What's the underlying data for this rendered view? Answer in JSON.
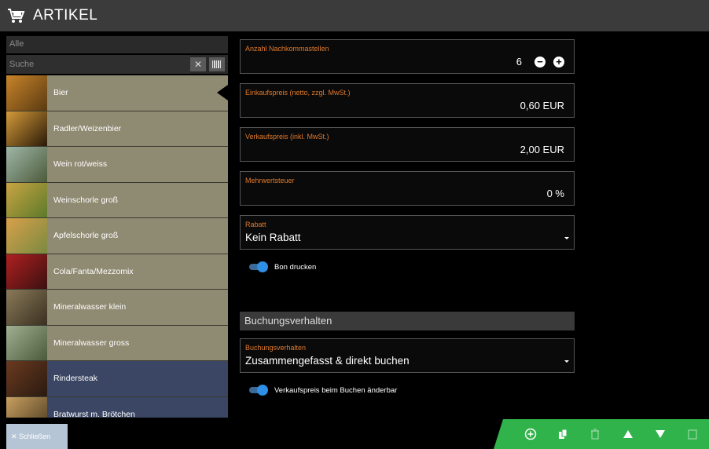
{
  "header": {
    "title": "ARTIKEL",
    "icon": "shopping-cart-icon"
  },
  "left": {
    "filter": "Alle",
    "search_placeholder": "Suche",
    "clear_icon": "✕",
    "barcode_icon": "barcode-icon",
    "items": [
      {
        "label": "Bier",
        "bg": "khaki",
        "selected": true
      },
      {
        "label": "Radler/Weizenbier",
        "bg": "khaki"
      },
      {
        "label": "Wein rot/weiss",
        "bg": "khaki"
      },
      {
        "label": "Weinschorle groß",
        "bg": "khaki"
      },
      {
        "label": "Apfelschorle groß",
        "bg": "khaki"
      },
      {
        "label": "Cola/Fanta/Mezzomix",
        "bg": "khaki"
      },
      {
        "label": "Mineralwasser klein",
        "bg": "khaki"
      },
      {
        "label": "Mineralwasser gross",
        "bg": "khaki"
      },
      {
        "label": "Rindersteak",
        "bg": "navy"
      },
      {
        "label": "Bratwurst m. Brötchen",
        "bg": "navy"
      }
    ]
  },
  "form": {
    "decimals": {
      "label": "Anzahl Nachkommastellen",
      "value": "6"
    },
    "purchase_price": {
      "label": "Einkaufspreis (netto, zzgl. MwSt.)",
      "value": "0,60 EUR"
    },
    "sale_price": {
      "label": "Verkaufspreis (inkl. MwSt.)",
      "value": "2,00 EUR"
    },
    "vat": {
      "label": "Mehrwertsteuer",
      "value": "0 %"
    },
    "discount": {
      "label": "Rabatt",
      "value": "Kein Rabatt"
    },
    "print_receipt": {
      "label": "Bon drucken",
      "on": true
    },
    "section_title": "Buchungsverhalten",
    "booking": {
      "label": "Buchungsverhalten",
      "value": "Zusammengefasst & direkt buchen"
    },
    "price_editable": {
      "label": "Verkaufspreis beim Buchen änderbar",
      "on": true
    }
  },
  "footer": {
    "close_label": "Schließen",
    "close_icon": "✕",
    "toolbar_icons": [
      "add-circle-icon",
      "copy-icon",
      "delete-icon",
      "arrow-up-icon",
      "arrow-down-icon",
      "trash-icon"
    ]
  },
  "colors": {
    "header_bg": "#3b3b3b",
    "item_khaki": "#8f8a72",
    "item_navy": "#3a4663",
    "label_orange": "#e07a2c",
    "toggle_blue": "#2f8ee5",
    "toolbar_green": "#2fb34a"
  }
}
